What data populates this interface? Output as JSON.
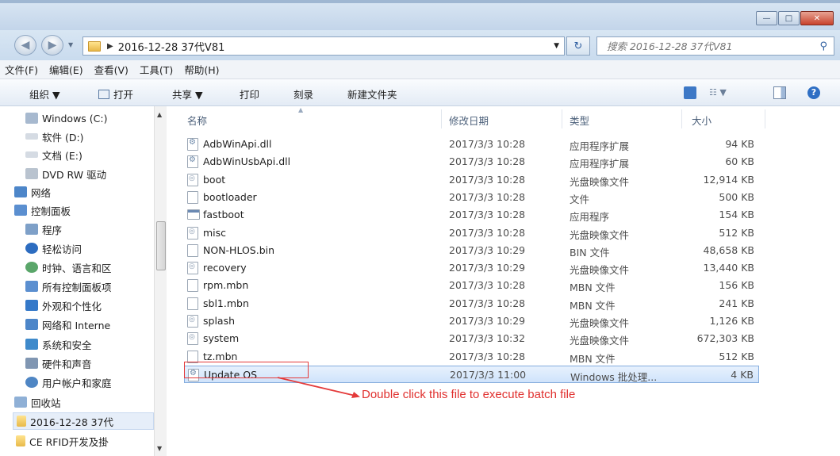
{
  "window": {
    "minimize_glyph": "—",
    "maximize_glyph": "□",
    "close_glyph": "✕"
  },
  "address_bar": {
    "path": "2016-12-28 37代V81",
    "search_placeholder": "搜索 2016-12-28 37代V81"
  },
  "menu": [
    "文件(F)",
    "编辑(E)",
    "查看(V)",
    "工具(T)",
    "帮助(H)"
  ],
  "toolbar": {
    "organize": "组织 ▼",
    "open": "打开",
    "share": "共享 ▼",
    "print": "打印",
    "burn": "刻录",
    "new_folder": "新建文件夹"
  },
  "sidebar": {
    "items": [
      {
        "label": "Windows (C:)",
        "icon": "drive-icon"
      },
      {
        "label": "软件 (D:)",
        "icon": "drive-icon"
      },
      {
        "label": "文档 (E:)",
        "icon": "drive-icon"
      },
      {
        "label": "DVD RW 驱动",
        "icon": "dvd-icon"
      },
      {
        "label": "网络",
        "icon": "network-icon"
      },
      {
        "label": "控制面板",
        "icon": "control-panel-icon"
      },
      {
        "label": "程序",
        "icon": "programs-icon"
      },
      {
        "label": "轻松访问",
        "icon": "accessibility-icon"
      },
      {
        "label": "时钟、语言和区",
        "icon": "clock-icon"
      },
      {
        "label": "所有控制面板项",
        "icon": "control-panel-icon"
      },
      {
        "label": "外观和个性化",
        "icon": "appearance-icon"
      },
      {
        "label": "网络和 Interne",
        "icon": "network-icon"
      },
      {
        "label": "系统和安全",
        "icon": "security-icon"
      },
      {
        "label": "硬件和声音",
        "icon": "hardware-icon"
      },
      {
        "label": "用户帐户和家庭",
        "icon": "users-icon"
      },
      {
        "label": "回收站",
        "icon": "recycle-bin-icon"
      },
      {
        "label": "2016-12-28 37代",
        "icon": "folder-icon"
      },
      {
        "label": "CE RFID开发及掛",
        "icon": "folder-icon"
      }
    ]
  },
  "columns": {
    "name": "名称",
    "date": "修改日期",
    "type": "类型",
    "size": "大小"
  },
  "files": [
    {
      "name": "AdbWinApi.dll",
      "date": "2017/3/3 10:28",
      "type": "应用程序扩展",
      "size": "94 KB",
      "icon": "gear"
    },
    {
      "name": "AdbWinUsbApi.dll",
      "date": "2017/3/3 10:28",
      "type": "应用程序扩展",
      "size": "60 KB",
      "icon": "gear"
    },
    {
      "name": "boot",
      "date": "2017/3/3 10:28",
      "type": "光盘映像文件",
      "size": "12,914 KB",
      "icon": "disc"
    },
    {
      "name": "bootloader",
      "date": "2017/3/3 10:28",
      "type": "文件",
      "size": "500 KB",
      "icon": "file"
    },
    {
      "name": "fastboot",
      "date": "2017/3/3 10:28",
      "type": "应用程序",
      "size": "154 KB",
      "icon": "app"
    },
    {
      "name": "misc",
      "date": "2017/3/3 10:28",
      "type": "光盘映像文件",
      "size": "512 KB",
      "icon": "disc"
    },
    {
      "name": "NON-HLOS.bin",
      "date": "2017/3/3 10:29",
      "type": "BIN 文件",
      "size": "48,658 KB",
      "icon": "file"
    },
    {
      "name": "recovery",
      "date": "2017/3/3 10:29",
      "type": "光盘映像文件",
      "size": "13,440 KB",
      "icon": "disc"
    },
    {
      "name": "rpm.mbn",
      "date": "2017/3/3 10:28",
      "type": "MBN 文件",
      "size": "156 KB",
      "icon": "file"
    },
    {
      "name": "sbl1.mbn",
      "date": "2017/3/3 10:28",
      "type": "MBN 文件",
      "size": "241 KB",
      "icon": "file"
    },
    {
      "name": "splash",
      "date": "2017/3/3 10:29",
      "type": "光盘映像文件",
      "size": "1,126 KB",
      "icon": "disc"
    },
    {
      "name": "system",
      "date": "2017/3/3 10:32",
      "type": "光盘映像文件",
      "size": "672,303 KB",
      "icon": "disc"
    },
    {
      "name": "tz.mbn",
      "date": "2017/3/3 10:28",
      "type": "MBN 文件",
      "size": "512 KB",
      "icon": "file"
    },
    {
      "name": "Update OS",
      "date": "2017/3/3 11:00",
      "type": "Windows 批处理...",
      "size": "4 KB",
      "icon": "gear",
      "selected": true
    }
  ],
  "annotation": {
    "text": "Double click this file to execute batch file",
    "color": "#e0302e"
  }
}
